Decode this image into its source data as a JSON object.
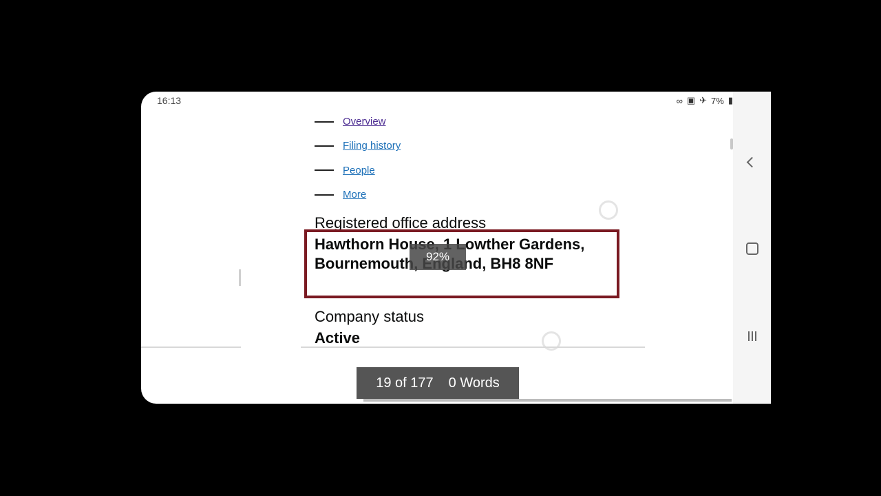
{
  "status_bar": {
    "time": "16:13",
    "battery": "7%",
    "icons": [
      "link-icon",
      "sim-icon",
      "airplane-icon",
      "battery-icon"
    ]
  },
  "nav_links": [
    {
      "label": "Overview"
    },
    {
      "label": "Filing history"
    },
    {
      "label": "People"
    },
    {
      "label": "More"
    }
  ],
  "registered_office": {
    "label": "Registered office address",
    "value": "Hawthorn House, 1 Lowther Gardens, Bournemouth, England, BH8 8NF"
  },
  "zoom_indicator": "92%",
  "company_status": {
    "label": "Company status",
    "value": "Active"
  },
  "find_bar": {
    "position": "19 of 177",
    "words": "0 Words"
  },
  "system_nav": [
    "back-icon",
    "home-icon",
    "recent-apps-icon"
  ],
  "colors": {
    "highlight_border": "#7a1a22",
    "link": "#1d70b8",
    "visited_link": "#4c2c92"
  }
}
